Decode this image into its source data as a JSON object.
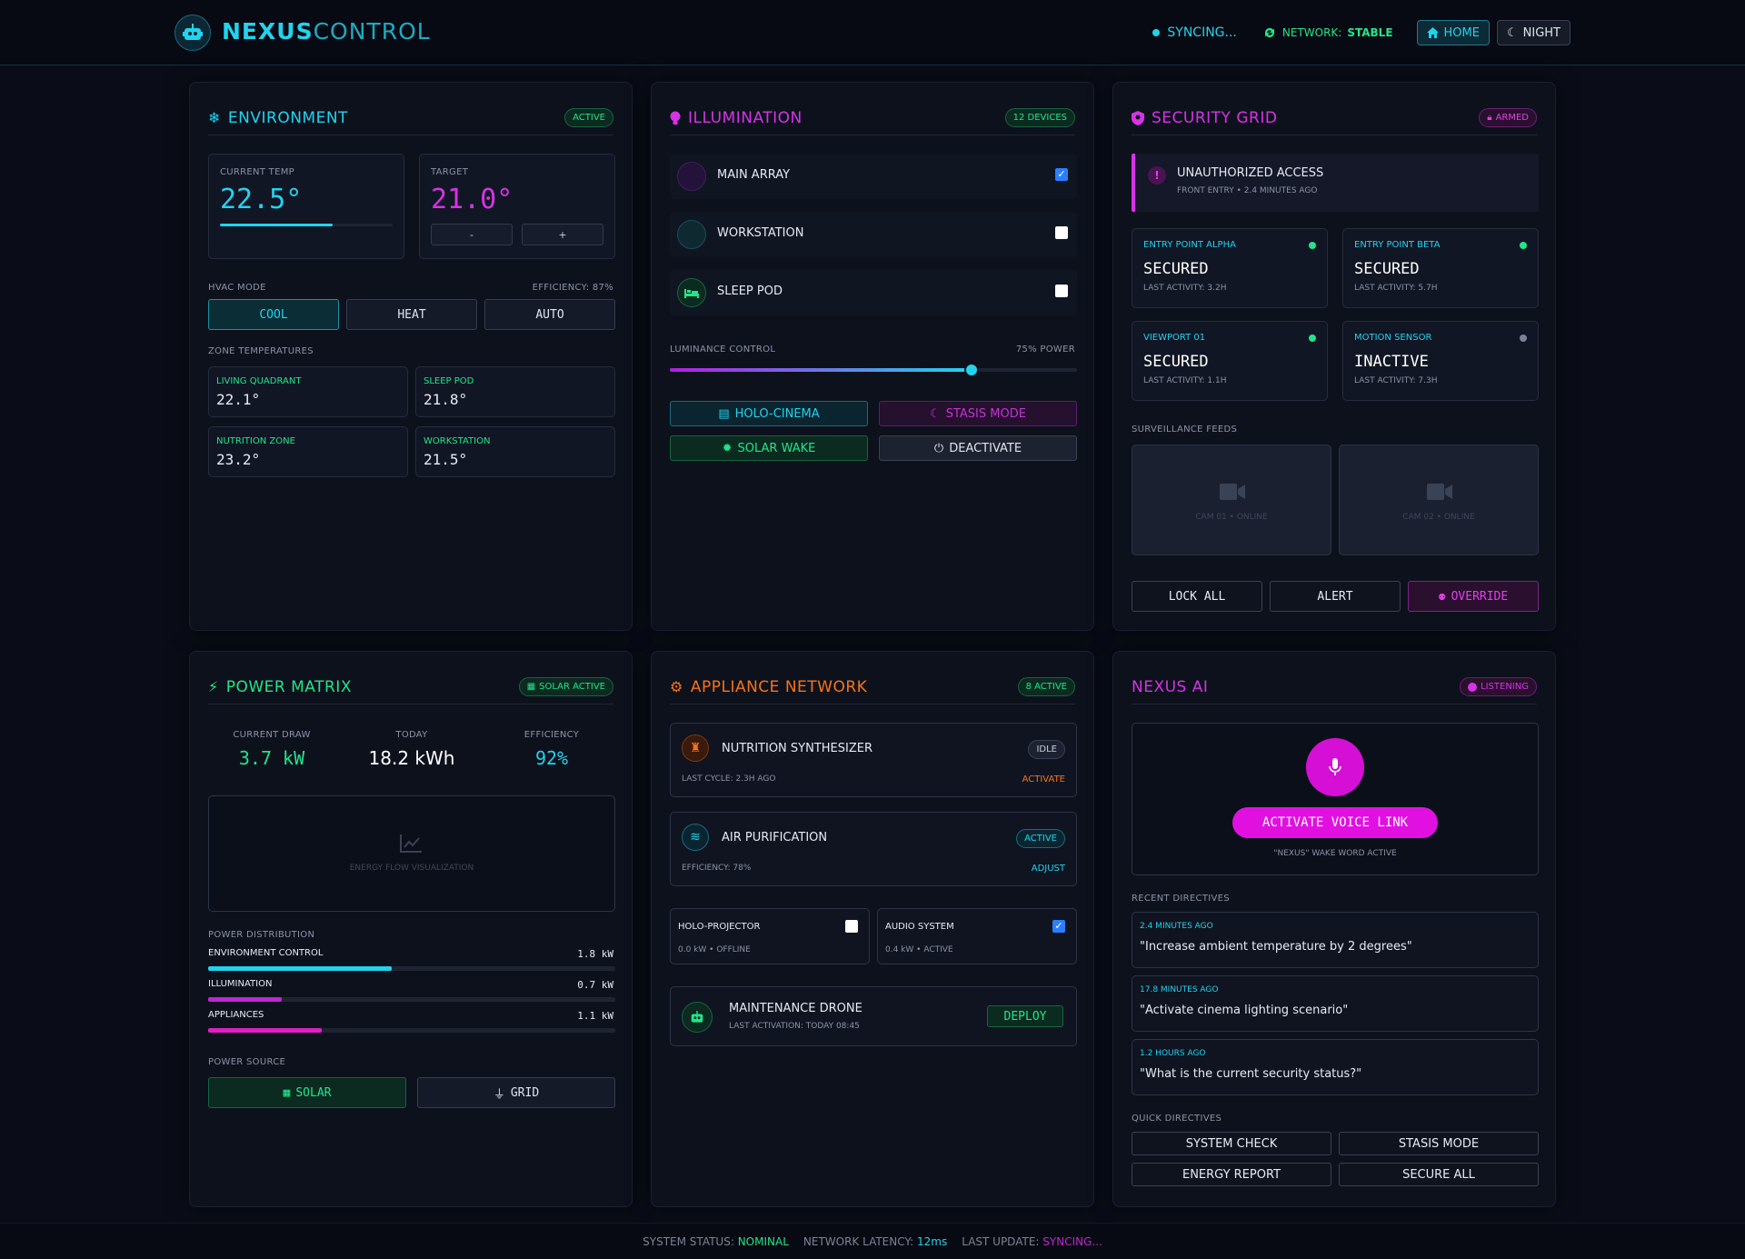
{
  "header": {
    "brand_a": "NEXUS",
    "brand_b": "CONTROL",
    "sync": "SYNCING...",
    "network_label": "NETWORK:",
    "network_status": "STABLE",
    "home": "HOME",
    "night": "NIGHT"
  },
  "env": {
    "title": "ENVIRONMENT",
    "badge": "ACTIVE",
    "current_label": "CURRENT TEMP",
    "current": "22.5°",
    "current_fraction": 0.65,
    "target_label": "TARGET",
    "target": "21.0°",
    "minus": "-",
    "plus": "+",
    "hvac_label": "HVAC MODE",
    "efficiency": "EFFICIENCY: 87%",
    "modes": [
      "COOL",
      "HEAT",
      "AUTO"
    ],
    "zones_label": "ZONE TEMPERATURES",
    "zones": [
      {
        "name": "LIVING QUADRANT",
        "temp": "22.1°"
      },
      {
        "name": "SLEEP POD",
        "temp": "21.8°"
      },
      {
        "name": "NUTRITION ZONE",
        "temp": "23.2°"
      },
      {
        "name": "WORKSTATION",
        "temp": "21.5°"
      }
    ]
  },
  "illum": {
    "title": "ILLUMINATION",
    "badge": "12 DEVICES",
    "lights": [
      {
        "name": "MAIN ARRAY",
        "on": true
      },
      {
        "name": "WORKSTATION",
        "on": false
      },
      {
        "name": "SLEEP POD",
        "on": false
      }
    ],
    "lum_label": "LUMINANCE CONTROL",
    "lum_value": "75% POWER",
    "lum_fraction": 0.74,
    "scenes": [
      "HOLO-CINEMA",
      "STASIS MODE",
      "SOLAR WAKE",
      "DEACTIVATE"
    ]
  },
  "security": {
    "title": "SECURITY GRID",
    "badge": "ARMED",
    "alert_title": "UNAUTHORIZED ACCESS",
    "alert_sub": "FRONT ENTRY • 2.4 MINUTES AGO",
    "points": [
      {
        "name": "ENTRY POINT ALPHA",
        "status": "SECURED",
        "last": "LAST ACTIVITY: 3.2H"
      },
      {
        "name": "ENTRY POINT BETA",
        "status": "SECURED",
        "last": "LAST ACTIVITY: 5.7H"
      },
      {
        "name": "VIEWPORT 01",
        "status": "SECURED",
        "last": "LAST ACTIVITY: 1.1H"
      },
      {
        "name": "MOTION SENSOR",
        "status": "INACTIVE",
        "last": "LAST ACTIVITY: 7.3H"
      }
    ],
    "feeds_label": "SURVEILLANCE FEEDS",
    "feeds": [
      "CAM 01 • ONLINE",
      "CAM 02 • ONLINE"
    ],
    "actions": [
      "LOCK ALL",
      "ALERT",
      "OVERRIDE"
    ]
  },
  "power": {
    "title": "POWER MATRIX",
    "badge": "SOLAR ACTIVE",
    "stats": [
      {
        "label": "CURRENT DRAW",
        "value": "3.7 kW"
      },
      {
        "label": "TODAY",
        "value": "18.2 kWh"
      },
      {
        "label": "EFFICIENCY",
        "value": "92%"
      }
    ],
    "viz": "ENERGY FLOW VISUALIZATION",
    "dist_label": "POWER DISTRIBUTION",
    "dist": [
      {
        "name": "ENVIRONMENT CONTROL",
        "value": "1.8 kW",
        "fraction": 0.45
      },
      {
        "name": "ILLUMINATION",
        "value": "0.7 kW",
        "fraction": 0.18
      },
      {
        "name": "APPLIANCES",
        "value": "1.1 kW",
        "fraction": 0.28
      }
    ],
    "source_label": "POWER SOURCE",
    "sources": [
      "SOLAR",
      "GRID"
    ]
  },
  "appl": {
    "title": "APPLIANCE NETWORK",
    "badge": "8 ACTIVE",
    "items": [
      {
        "name": "NUTRITION SYNTHESIZER",
        "status": "IDLE",
        "sub": "LAST CYCLE: 2.3H AGO",
        "action": "ACTIVATE"
      },
      {
        "name": "AIR PURIFICATION",
        "status": "ACTIVE",
        "sub": "EFFICIENCY: 78%",
        "action": "ADJUST"
      }
    ],
    "small": [
      {
        "name": "HOLO-PROJECTOR",
        "sub": "0.0 kW • OFFLINE",
        "on": false
      },
      {
        "name": "AUDIO SYSTEM",
        "sub": "0.4 kW • ACTIVE",
        "on": true
      }
    ],
    "drone": {
      "name": "MAINTENANCE DRONE",
      "sub": "LAST ACTIVATION: TODAY 08:45",
      "action": "DEPLOY"
    }
  },
  "ai": {
    "title": "NEXUS AI",
    "badge": "LISTENING",
    "voice": "ACTIVATE VOICE LINK",
    "wake": "\"NEXUS\" WAKE WORD ACTIVE",
    "recent_label": "RECENT DIRECTIVES",
    "directives": [
      {
        "time": "2.4 MINUTES AGO",
        "text": "\"Increase ambient temperature by 2 degrees\""
      },
      {
        "time": "17.8 MINUTES AGO",
        "text": "\"Activate cinema lighting scenario\""
      },
      {
        "time": "1.2 HOURS AGO",
        "text": "\"What is the current security status?\""
      }
    ],
    "quick_label": "QUICK DIRECTIVES",
    "quick": [
      "SYSTEM CHECK",
      "STASIS MODE",
      "ENERGY REPORT",
      "SECURE ALL"
    ]
  },
  "footer": {
    "status_label": "SYSTEM STATUS:",
    "status": "NOMINAL",
    "latency_label": "NETWORK LATENCY:",
    "latency": "12ms",
    "update_label": "LAST UPDATE:",
    "update": "SYNCING..."
  },
  "colors": {
    "cyan": "#22d3ee",
    "green": "#22e58a",
    "magenta": "#e020e0",
    "orange": "#f97316"
  }
}
